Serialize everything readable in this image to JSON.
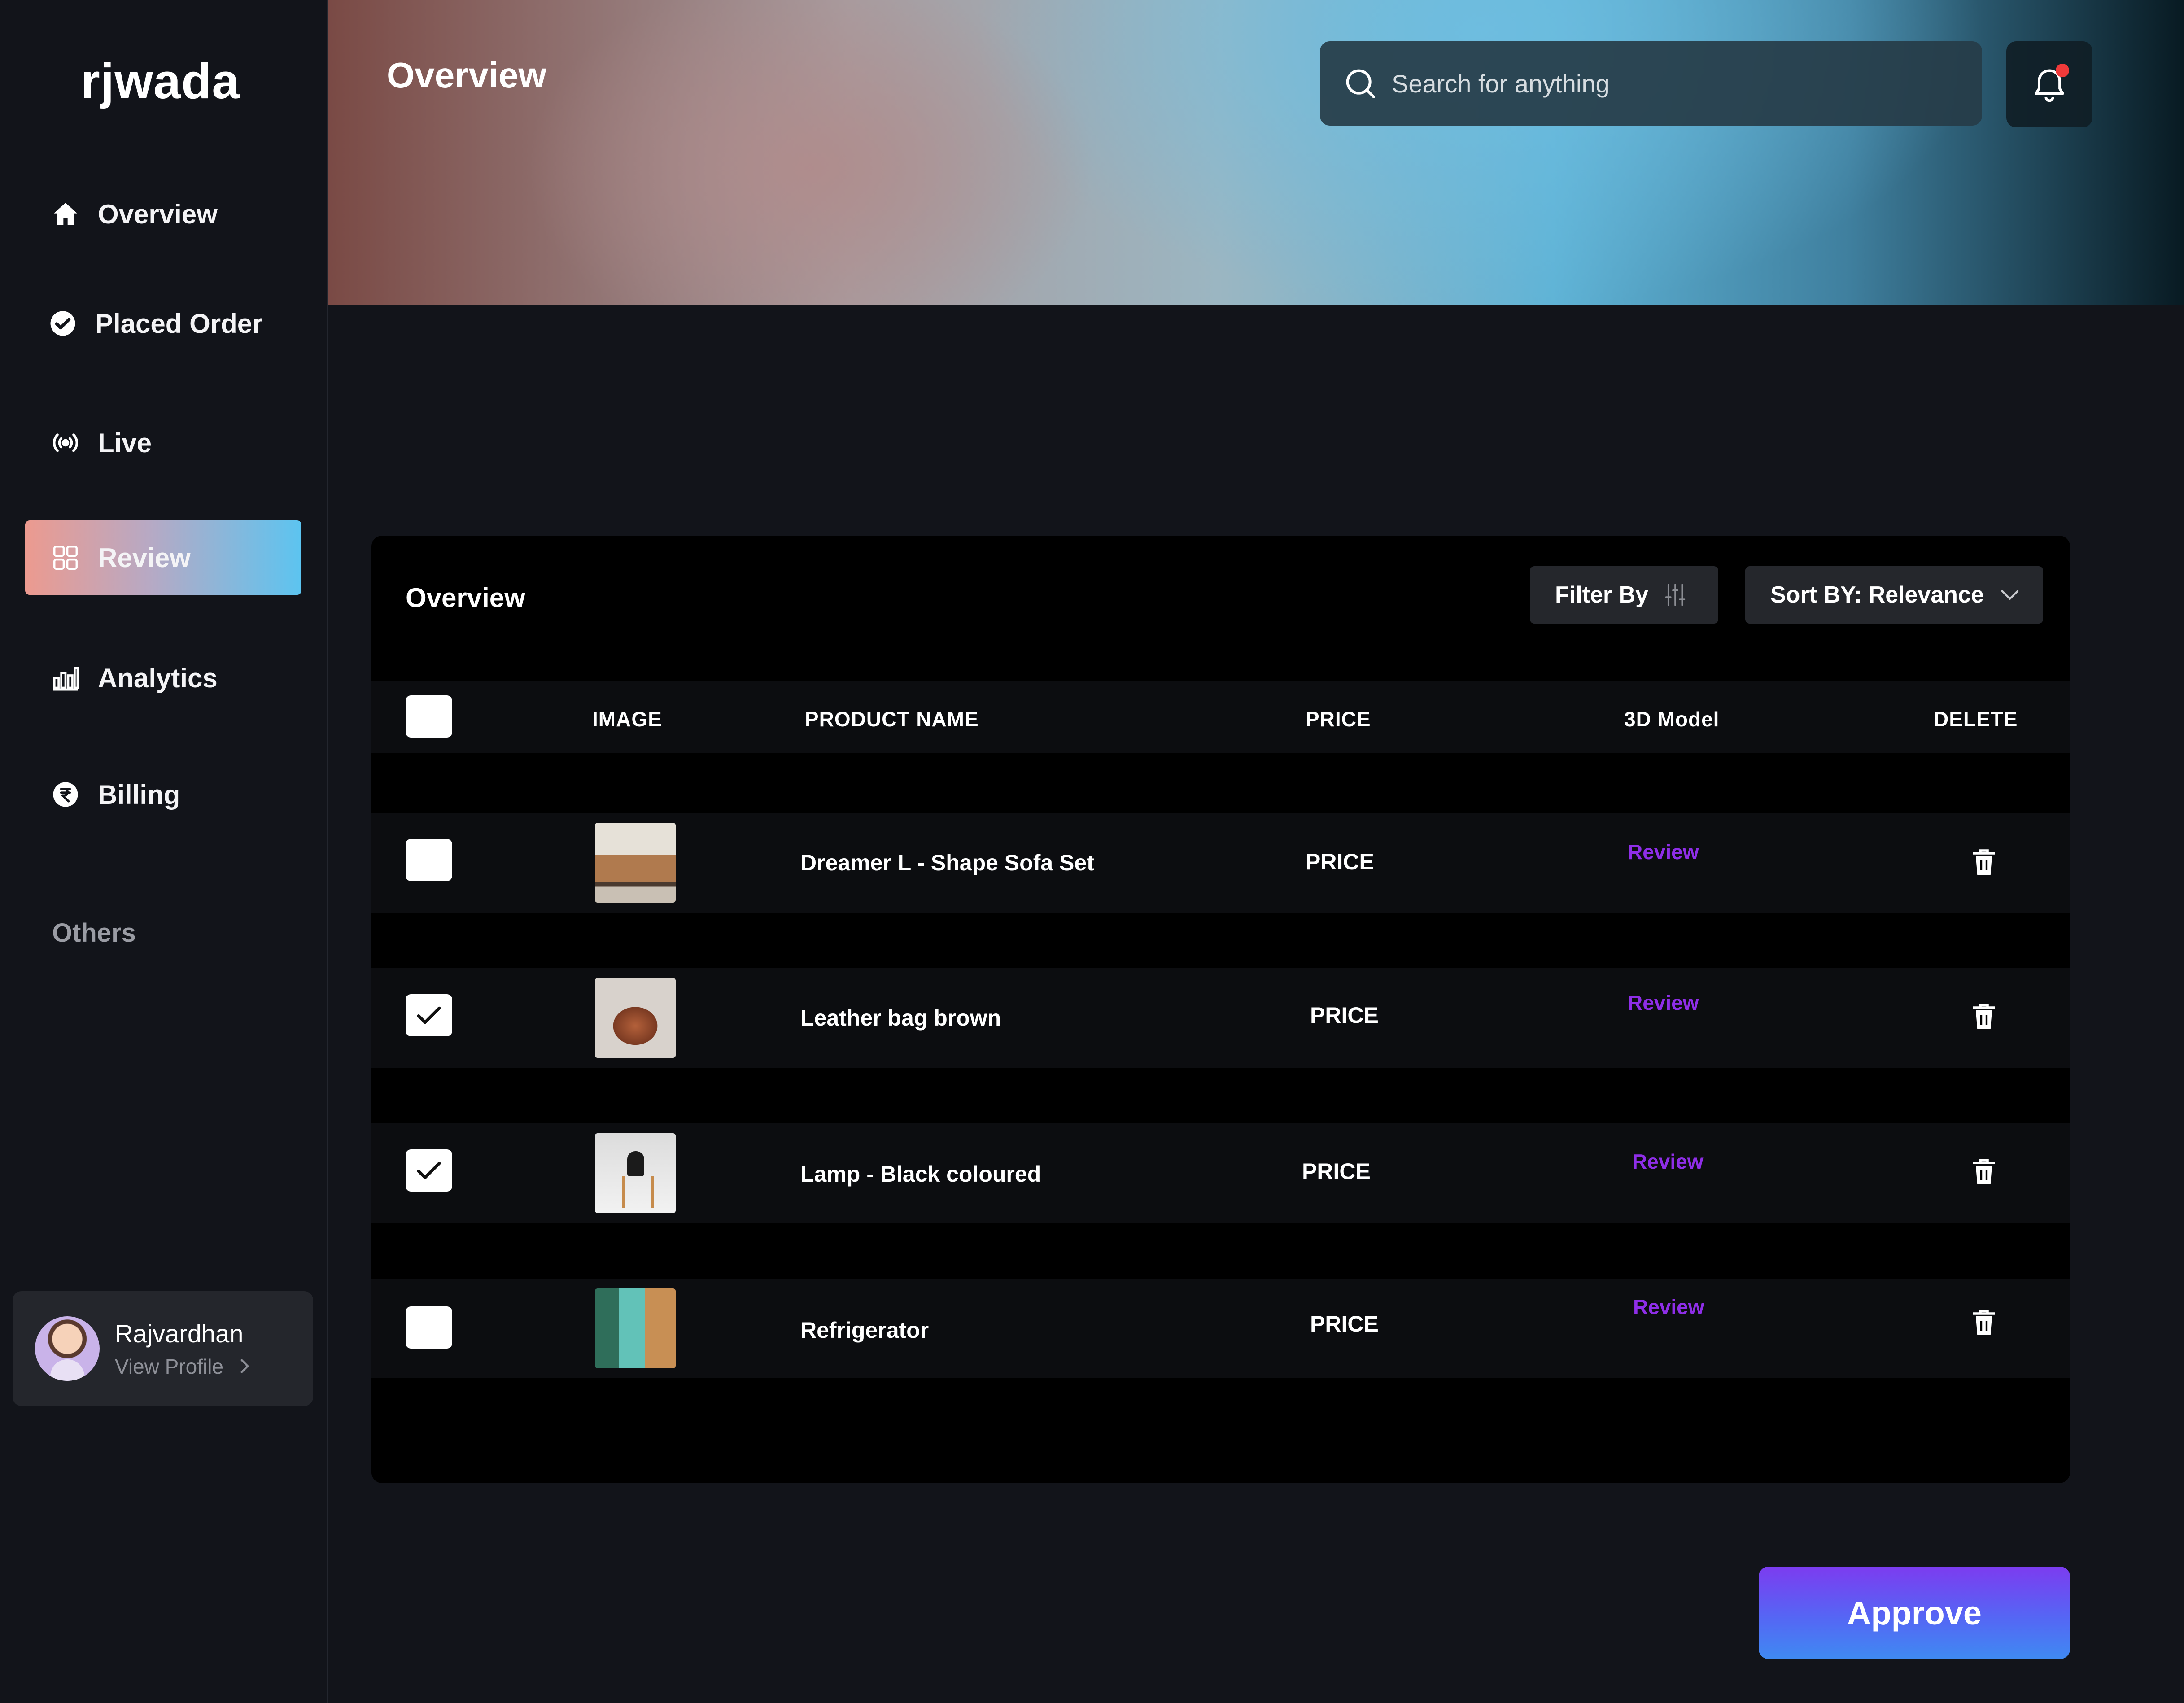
{
  "brand": "rjwada",
  "sidebar": {
    "items": [
      {
        "label": "Overview",
        "icon": "home-icon"
      },
      {
        "label": "Placed Order",
        "icon": "check-circle-icon"
      },
      {
        "label": "Live",
        "icon": "broadcast-icon"
      },
      {
        "label": "Review",
        "icon": "grid-icon",
        "active": true
      },
      {
        "label": "Analytics",
        "icon": "bar-chart-icon"
      },
      {
        "label": "Billing",
        "icon": "rupee-icon"
      }
    ],
    "section_label": "Others"
  },
  "profile": {
    "name": "Rajvardhan",
    "link": "View Profile"
  },
  "header": {
    "title": "Overview",
    "search_placeholder": "Search for anything",
    "notification_dot_color": "#f03a3a"
  },
  "card": {
    "title": "Overview",
    "filter_label": "Filter By",
    "sort_label": "Sort BY: Relevance",
    "columns": {
      "image": "IMAGE",
      "product_name": "PRODUCT NAME",
      "price": "PRICE",
      "model": "3D Model",
      "delete": "DELETE"
    },
    "rows": [
      {
        "name": "Dreamer L - Shape Sofa Set",
        "price": "PRICE",
        "model": "Review",
        "checked": false
      },
      {
        "name": "Leather bag brown",
        "price": "PRICE",
        "model": "Review",
        "checked": true
      },
      {
        "name": "Lamp - Black coloured",
        "price": "PRICE",
        "model": "Review",
        "checked": true
      },
      {
        "name": "Refrigerator",
        "price": "PRICE",
        "model": "Review",
        "checked": false
      }
    ]
  },
  "approve_label": "Approve",
  "colors": {
    "accent_purple": "#8f2ee8",
    "active_gradient": [
      "#ec9a8f",
      "#5cc4f0"
    ],
    "approve_gradient": [
      "#7c3cf0",
      "#3f8af2"
    ]
  }
}
